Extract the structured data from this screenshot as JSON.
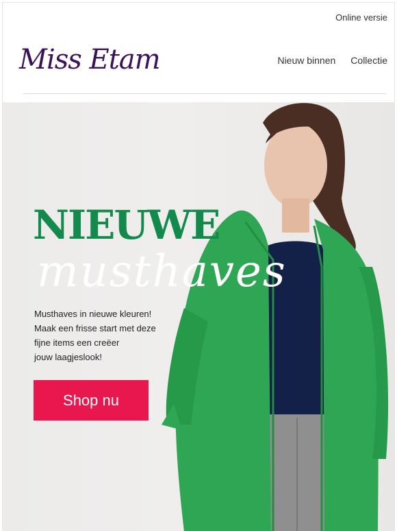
{
  "header": {
    "online_version": "Online versie",
    "logo_text": "Miss Etam",
    "nav": [
      "Nieuw binnen",
      "Collectie"
    ]
  },
  "hero": {
    "headline": "NIEUWE",
    "script_word": "musthaves",
    "body_lines": [
      "Musthaves in nieuwe kleuren!",
      "Maak een frisse start met deze",
      "fijne items een creëer",
      "jouw laagjeslook!"
    ],
    "cta": "Shop nu"
  },
  "colors": {
    "brand_purple": "#3b1158",
    "headline_green": "#13894b",
    "cta_pink": "#e8174e",
    "cardigan_green": "#2fa653"
  }
}
